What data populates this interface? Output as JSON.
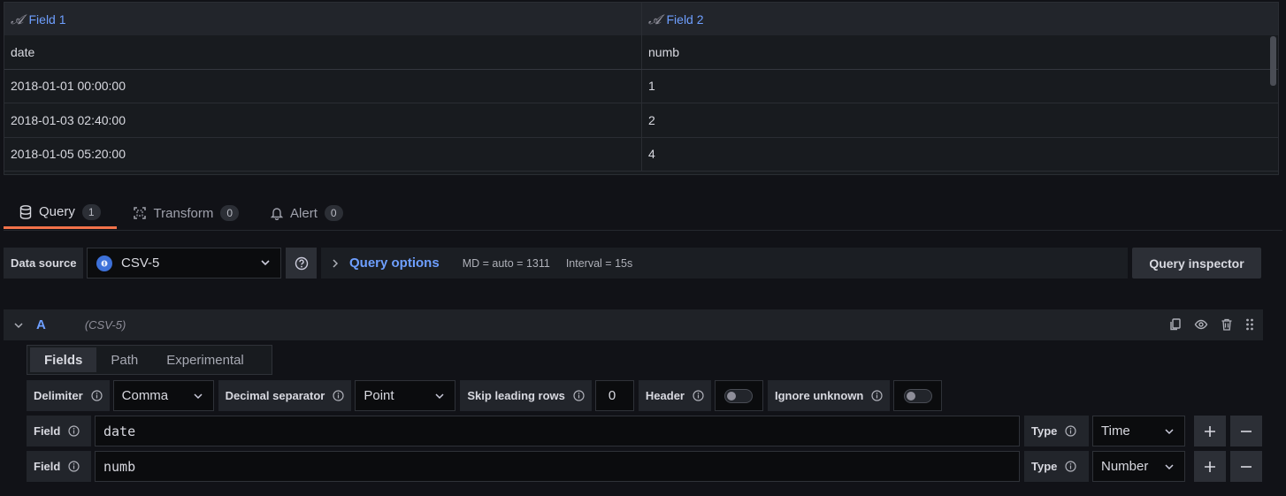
{
  "table": {
    "columns": [
      "Field 1",
      "Field 2"
    ],
    "type_glyph": "𝓐",
    "rows": [
      [
        "date",
        "numb"
      ],
      [
        "2018-01-01 00:00:00",
        "1"
      ],
      [
        "2018-01-03 02:40:00",
        "2"
      ],
      [
        "2018-01-05 05:20:00",
        "4"
      ]
    ]
  },
  "tabs": [
    {
      "label": "Query",
      "count": "1",
      "icon": "database-icon"
    },
    {
      "label": "Transform",
      "count": "0",
      "icon": "transform-icon"
    },
    {
      "label": "Alert",
      "count": "0",
      "icon": "bell-icon"
    }
  ],
  "toolbar": {
    "datasource_label": "Data source",
    "datasource_value": "CSV-5",
    "query_options_label": "Query options",
    "md": "MD = auto = 1311",
    "interval": "Interval = 15s",
    "query_inspector_label": "Query inspector"
  },
  "query": {
    "ref_id": "A",
    "datasource": "(CSV-5)"
  },
  "editor": {
    "tabs": [
      "Fields",
      "Path",
      "Experimental"
    ],
    "delimiter_label": "Delimiter",
    "delimiter_value": "Comma",
    "decimal_label": "Decimal separator",
    "decimal_value": "Point",
    "skip_label": "Skip leading rows",
    "skip_value": "0",
    "header_label": "Header",
    "header_enabled": false,
    "ignore_label": "Ignore unknown",
    "ignore_enabled": false,
    "fields": [
      {
        "label": "Field",
        "value": "date",
        "type_label": "Type",
        "type_value": "Time"
      },
      {
        "label": "Field",
        "value": "numb",
        "type_label": "Type",
        "type_value": "Number"
      }
    ]
  },
  "colors": {
    "accent_blue": "#6e9fff",
    "active_tab_orange": "#f2724a",
    "background": "#111217"
  }
}
